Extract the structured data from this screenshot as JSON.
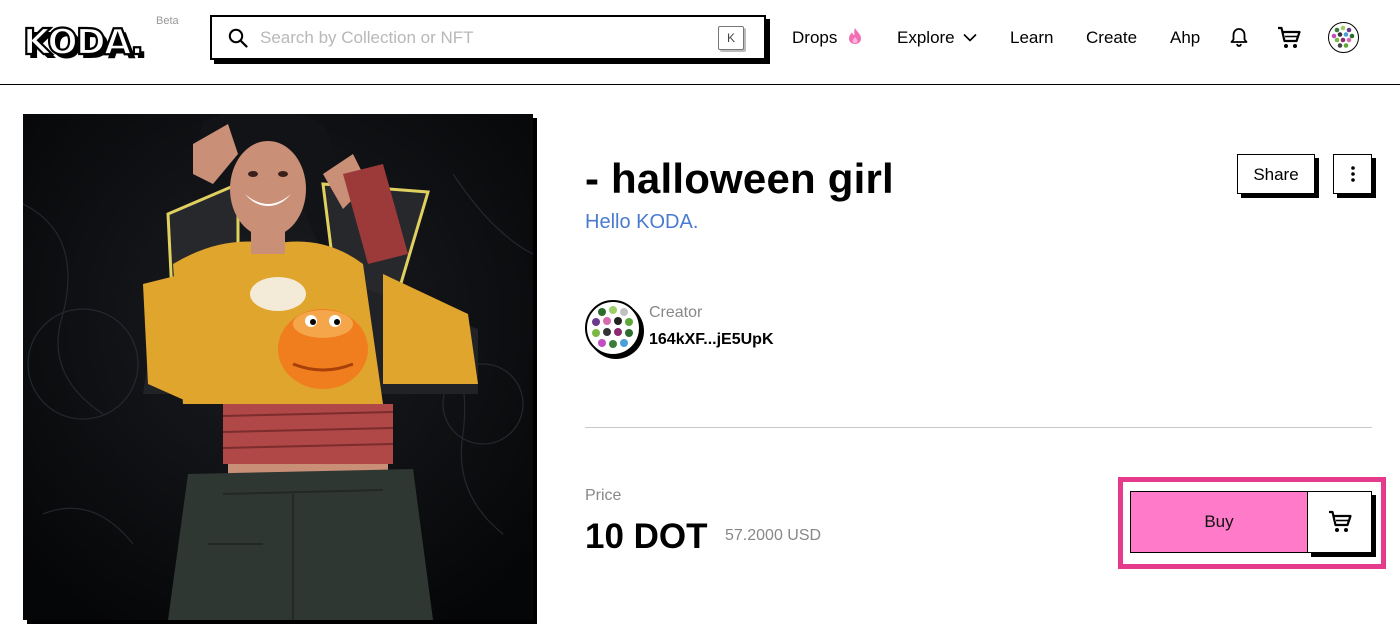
{
  "header": {
    "logo_text": "KODA",
    "beta_label": "Beta",
    "search": {
      "placeholder": "Search by Collection or NFT",
      "value": "",
      "shortcut_key": "K"
    },
    "nav": {
      "drops": "Drops",
      "explore": "Explore",
      "learn": "Learn",
      "create": "Create",
      "account": "Ahp"
    },
    "icons": [
      "search-icon",
      "flame-icon",
      "chevron-down-icon",
      "bell-icon",
      "cart-icon",
      "avatar-icon"
    ]
  },
  "nft": {
    "title": "- halloween girl",
    "description": "Hello KODA.",
    "share_label": "Share",
    "creator": {
      "label": "Creator",
      "address": "164kXF...jE5UpK"
    },
    "price": {
      "label": "Price",
      "value": "10 DOT",
      "usd": "57.2000 USD"
    },
    "buy_label": "Buy"
  },
  "colors": {
    "accent_pink": "#ff7ac8",
    "highlight": "#e63a8c",
    "link_blue": "#4a7bd0",
    "muted_text": "#888888"
  }
}
